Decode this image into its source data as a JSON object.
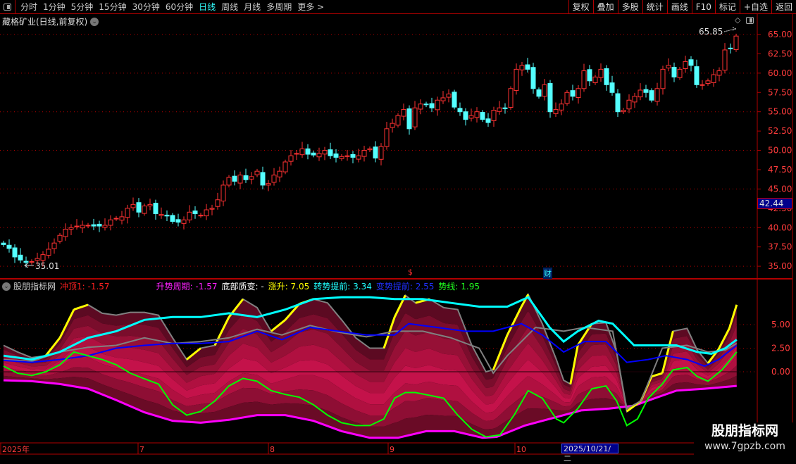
{
  "toolbar": {
    "periods": [
      "分时",
      "1分钟",
      "5分钟",
      "15分钟",
      "30分钟",
      "60分钟",
      "日线",
      "周线",
      "月线",
      "多周期",
      "更多 >"
    ],
    "active_period": "日线",
    "buttons": [
      "复权",
      "叠加",
      "多股",
      "统计",
      "画线",
      "F10",
      "标记",
      "+自选",
      "返回"
    ]
  },
  "title": "藏格矿业(日线,前复权)",
  "price_axis": {
    "labels": [
      "65.00",
      "62.50",
      "60.00",
      "57.50",
      "55.00",
      "52.50",
      "50.00",
      "47.50",
      "45.00",
      "42.50",
      "40.00",
      "37.50",
      "35.00"
    ],
    "current_price": "42.44"
  },
  "annotations": {
    "high": "65.85",
    "low": "35.01",
    "marker_dollar": "$",
    "marker_cai": "财"
  },
  "indicator": {
    "name": "股朋指标网",
    "legend": [
      {
        "text": "冲顶1: -1.57",
        "color": "#ff2020"
      },
      {
        "text": "升势周期: -1.57",
        "color": "#ff20ff"
      },
      {
        "text": "底部质变: -",
        "color": "#ffffff"
      },
      {
        "text": "涨升: 7.05",
        "color": "#ffff00"
      },
      {
        "text": "转势提前: 3.34",
        "color": "#20ffff"
      },
      {
        "text": "变势提前: 2.55",
        "color": "#2030ff"
      },
      {
        "text": "势线: 1.95",
        "color": "#20ff20"
      }
    ],
    "axis_labels": [
      "5.00",
      "2.50",
      "0.00"
    ]
  },
  "date_axis": {
    "labels": [
      "2025年",
      "7",
      "8",
      "9",
      "10"
    ],
    "highlight": "2025/10/21/二"
  },
  "watermark": {
    "title": "股朋指标网",
    "url": "www.7gpzb.com"
  },
  "chart_data": {
    "type": "candlestick",
    "price_range": [
      34,
      66.5
    ],
    "closes": [
      37.8,
      37.3,
      36.2,
      35.8,
      35.5,
      35.6,
      36.0,
      36.5,
      37.2,
      38.0,
      39.0,
      39.8,
      40.0,
      40.2,
      40.3,
      40.3,
      40.2,
      40.2,
      40.3,
      41.0,
      41.2,
      41.4,
      42.5,
      43.0,
      42.0,
      42.8,
      43.0,
      41.8,
      41.7,
      41.5,
      40.8,
      40.7,
      41.0,
      42.0,
      41.8,
      41.6,
      42.3,
      42.5,
      43.6,
      45.5,
      46.5,
      46.0,
      46.8,
      46.2,
      46.6,
      47.3,
      45.5,
      45.7,
      46.8,
      47.3,
      48.5,
      49.3,
      49.6,
      50.2,
      49.5,
      49.4,
      49.6,
      50.0,
      49.3,
      49.1,
      49.2,
      49.3,
      49.1,
      49.3,
      50.0,
      50.2,
      49.0,
      50.5,
      52.8,
      53.5,
      54.5,
      55.3,
      52.8,
      55.5,
      56.0,
      55.9,
      55.5,
      56.5,
      56.8,
      57.3,
      55.6,
      55.0,
      54.0,
      54.5,
      55.0,
      54.0,
      53.6,
      55.2,
      55.5,
      55.4,
      58.0,
      60.5,
      61.0,
      60.5,
      58.0,
      57.0,
      58.5,
      55.0,
      55.3,
      56.0,
      57.5,
      57.0,
      58.0,
      60.3,
      59.0,
      59.5,
      60.5,
      58.5,
      57.5,
      55.0,
      55.2,
      56.5,
      57.0,
      57.8,
      57.5,
      56.5,
      58.0,
      60.5,
      61.0,
      59.5,
      60.5,
      61.5,
      61.0,
      58.5,
      58.5,
      59.0,
      59.8,
      60.3,
      63.0,
      63.2,
      64.8
    ],
    "indicator_range": [
      -8,
      9
    ],
    "series": {
      "top": [
        [
          0,
          2.8
        ],
        [
          2.5,
          2.1
        ],
        [
          5,
          1.5
        ],
        [
          7.5,
          1.7
        ],
        [
          10,
          3.6
        ],
        [
          12.5,
          6.6
        ],
        [
          15,
          7.1
        ],
        [
          17.5,
          6.2
        ],
        [
          20,
          6.0
        ],
        [
          22.5,
          6.3
        ],
        [
          25,
          6.3
        ],
        [
          27.5,
          6.0
        ],
        [
          30,
          3.6
        ],
        [
          32.5,
          1.3
        ],
        [
          35,
          2.5
        ],
        [
          37.5,
          2.8
        ],
        [
          40,
          5.8
        ],
        [
          42.5,
          7.7
        ],
        [
          45,
          6.8
        ],
        [
          47.5,
          4.3
        ],
        [
          50,
          5.5
        ],
        [
          52.5,
          7.2
        ],
        [
          55,
          7.7
        ],
        [
          57.5,
          7.3
        ],
        [
          60,
          5.5
        ],
        [
          62.5,
          3.6
        ],
        [
          65,
          2.5
        ],
        [
          67.5,
          2.5
        ],
        [
          69.4,
          5.8
        ],
        [
          71.3,
          8.1
        ],
        [
          73.1,
          7.3
        ],
        [
          75.6,
          7.7
        ],
        [
          78.1,
          6.8
        ],
        [
          80.6,
          6.6
        ],
        [
          83.1,
          2.8
        ],
        [
          85.6,
          0
        ],
        [
          86.9,
          0.2
        ],
        [
          89.4,
          3.9
        ],
        [
          91.9,
          6.9
        ],
        [
          93.1,
          8.2
        ],
        [
          95.6,
          5.1
        ],
        [
          98.1,
          1.3
        ],
        [
          99.4,
          -0.9
        ],
        [
          100.6,
          -1.3
        ],
        [
          101.9,
          2.8
        ],
        [
          104.4,
          5.1
        ],
        [
          106.9,
          5.2
        ],
        [
          108.8,
          2.1
        ],
        [
          110.6,
          -4.2
        ],
        [
          113.1,
          -3.1
        ],
        [
          115,
          -0.5
        ],
        [
          116.9,
          -0.15
        ],
        [
          118.8,
          4.3
        ],
        [
          121.3,
          4.6
        ],
        [
          123.1,
          2.3
        ],
        [
          125,
          0.9
        ],
        [
          126.9,
          2.4
        ],
        [
          128.8,
          4.6
        ],
        [
          130.1,
          7.1
        ]
      ],
      "cyan": [
        [
          0,
          1.7
        ],
        [
          5,
          1.3
        ],
        [
          10,
          2.1
        ],
        [
          15,
          3.6
        ],
        [
          20,
          4.3
        ],
        [
          25,
          5.5
        ],
        [
          30,
          5.8
        ],
        [
          35,
          5.8
        ],
        [
          40,
          6.2
        ],
        [
          45,
          5.8
        ],
        [
          50,
          6.6
        ],
        [
          55,
          7.7
        ],
        [
          60,
          7.9
        ],
        [
          65,
          7.9
        ],
        [
          69.4,
          7.7
        ],
        [
          74.4,
          7.7
        ],
        [
          79.4,
          7.3
        ],
        [
          84.4,
          6.9
        ],
        [
          89.4,
          6.9
        ],
        [
          93.1,
          7.9
        ],
        [
          96.9,
          4.7
        ],
        [
          99.4,
          3.2
        ],
        [
          101.9,
          4.3
        ],
        [
          105.6,
          5.4
        ],
        [
          108.1,
          5.1
        ],
        [
          111.9,
          2.8
        ],
        [
          115.6,
          2.8
        ],
        [
          119.4,
          2.8
        ],
        [
          123.1,
          2.1
        ],
        [
          125.6,
          1.9
        ],
        [
          128.1,
          2.5
        ],
        [
          130.1,
          3.4
        ]
      ],
      "blue": [
        [
          0,
          1.2
        ],
        [
          5,
          1.0
        ],
        [
          10,
          1.3
        ],
        [
          15,
          1.7
        ],
        [
          20,
          2.5
        ],
        [
          25,
          2.8
        ],
        [
          30,
          3.0
        ],
        [
          35,
          3.0
        ],
        [
          40,
          3.2
        ],
        [
          45,
          4.3
        ],
        [
          49.4,
          3.4
        ],
        [
          54.4,
          4.7
        ],
        [
          59.4,
          4.3
        ],
        [
          64.4,
          3.9
        ],
        [
          69.4,
          3.9
        ],
        [
          71.9,
          5.1
        ],
        [
          76.9,
          4.7
        ],
        [
          81.9,
          4.3
        ],
        [
          86.9,
          4.3
        ],
        [
          91.9,
          5.1
        ],
        [
          95.6,
          3.9
        ],
        [
          99.4,
          2.1
        ],
        [
          103.1,
          3.2
        ],
        [
          106.9,
          3.2
        ],
        [
          110.6,
          1.0
        ],
        [
          114.4,
          1.3
        ],
        [
          117.5,
          1.7
        ],
        [
          121.3,
          1.3
        ],
        [
          124.4,
          0.6
        ],
        [
          126.9,
          1.3
        ],
        [
          130.1,
          2.8
        ]
      ],
      "gray": [
        [
          0,
          1.3
        ],
        [
          5,
          1.1
        ],
        [
          10,
          2.1
        ],
        [
          15,
          2.6
        ],
        [
          20,
          2.8
        ],
        [
          25,
          3.6
        ],
        [
          30,
          3.0
        ],
        [
          35,
          3.2
        ],
        [
          40,
          3.6
        ],
        [
          45,
          4.5
        ],
        [
          49.4,
          3.9
        ],
        [
          54.4,
          4.9
        ],
        [
          59.4,
          4.2
        ],
        [
          64.4,
          3.7
        ],
        [
          69.4,
          4.3
        ],
        [
          74.4,
          4.3
        ],
        [
          79.4,
          3.6
        ],
        [
          84.4,
          2.5
        ],
        [
          86.9,
          -0.15
        ],
        [
          89.4,
          1.7
        ],
        [
          94.4,
          4.7
        ],
        [
          99.4,
          4.3
        ],
        [
          103.1,
          4.7
        ],
        [
          108.1,
          4.3
        ],
        [
          110.6,
          -3.9
        ],
        [
          113.1,
          -3.1
        ],
        [
          116.9,
          2.5
        ],
        [
          121.3,
          2.8
        ],
        [
          125,
          2.1
        ],
        [
          128.1,
          2.3
        ],
        [
          130.1,
          3.0
        ]
      ],
      "green": [
        [
          0,
          0.6
        ],
        [
          2.5,
          -0.15
        ],
        [
          5,
          -0.4
        ],
        [
          7.5,
          0
        ],
        [
          10,
          0.75
        ],
        [
          12.5,
          2.1
        ],
        [
          15,
          1.7
        ],
        [
          17.5,
          1.3
        ],
        [
          20,
          0.75
        ],
        [
          22.5,
          -0.15
        ],
        [
          25,
          -0.75
        ],
        [
          27.5,
          -1.3
        ],
        [
          30,
          -3.5
        ],
        [
          32.5,
          -4.6
        ],
        [
          35,
          -4.2
        ],
        [
          37.5,
          -3.1
        ],
        [
          40,
          -1.5
        ],
        [
          42.5,
          -0.7
        ],
        [
          45,
          -1.0
        ],
        [
          47.5,
          -2.0
        ],
        [
          50,
          -2.4
        ],
        [
          52.5,
          -2.7
        ],
        [
          55,
          -3.5
        ],
        [
          57.5,
          -4.6
        ],
        [
          60,
          -5.4
        ],
        [
          62.5,
          -5.7
        ],
        [
          65,
          -5.7
        ],
        [
          67.5,
          -5.0
        ],
        [
          69.4,
          -2.8
        ],
        [
          71.3,
          -2.2
        ],
        [
          73.1,
          -2.2
        ],
        [
          75.6,
          -2.5
        ],
        [
          78.1,
          -2.8
        ],
        [
          80.6,
          -4.6
        ],
        [
          83.1,
          -6.1
        ],
        [
          85.6,
          -6.9
        ],
        [
          88.1,
          -6.7
        ],
        [
          90.6,
          -4.6
        ],
        [
          93.1,
          -2.0
        ],
        [
          95.6,
          -2.8
        ],
        [
          98.1,
          -5.0
        ],
        [
          99.4,
          -5.4
        ],
        [
          101.9,
          -3.9
        ],
        [
          104.4,
          -1.8
        ],
        [
          106.9,
          -1.5
        ],
        [
          108.8,
          -3.1
        ],
        [
          110.6,
          -5.7
        ],
        [
          112.5,
          -5.0
        ],
        [
          114.4,
          -2.8
        ],
        [
          116.9,
          -1.3
        ],
        [
          118.8,
          0.2
        ],
        [
          121.3,
          0.45
        ],
        [
          123.1,
          -0.5
        ],
        [
          125,
          -1.0
        ],
        [
          127.5,
          0.2
        ],
        [
          130.1,
          2.1
        ]
      ],
      "magenta": [
        [
          0,
          -0.9
        ],
        [
          5,
          -1.0
        ],
        [
          10,
          -1.3
        ],
        [
          15,
          -1.8
        ],
        [
          20,
          -3.0
        ],
        [
          25,
          -4.3
        ],
        [
          30,
          -5.2
        ],
        [
          35,
          -5.4
        ],
        [
          40,
          -5.1
        ],
        [
          45,
          -4.6
        ],
        [
          50,
          -4.6
        ],
        [
          55,
          -5.2
        ],
        [
          60,
          -6.3
        ],
        [
          65,
          -7.0
        ],
        [
          70,
          -7.0
        ],
        [
          75,
          -6.3
        ],
        [
          80,
          -6.3
        ],
        [
          85,
          -7.0
        ],
        [
          87.5,
          -6.9
        ],
        [
          92.5,
          -5.7
        ],
        [
          97.5,
          -4.9
        ],
        [
          102.5,
          -4.1
        ],
        [
          107.5,
          -3.9
        ],
        [
          111.9,
          -3.6
        ],
        [
          115.6,
          -2.8
        ],
        [
          119.4,
          -2.0
        ],
        [
          124.4,
          -1.8
        ],
        [
          130.1,
          -1.5
        ]
      ]
    },
    "colors": {
      "up": "#ff3232",
      "down": "#54ffff",
      "top": "#808080",
      "rise": "#ffff00",
      "cyan": "#00ffff",
      "blue": "#0000ff",
      "gray": "#808080",
      "green": "#00ff00",
      "magenta": "#ff00ff"
    }
  }
}
